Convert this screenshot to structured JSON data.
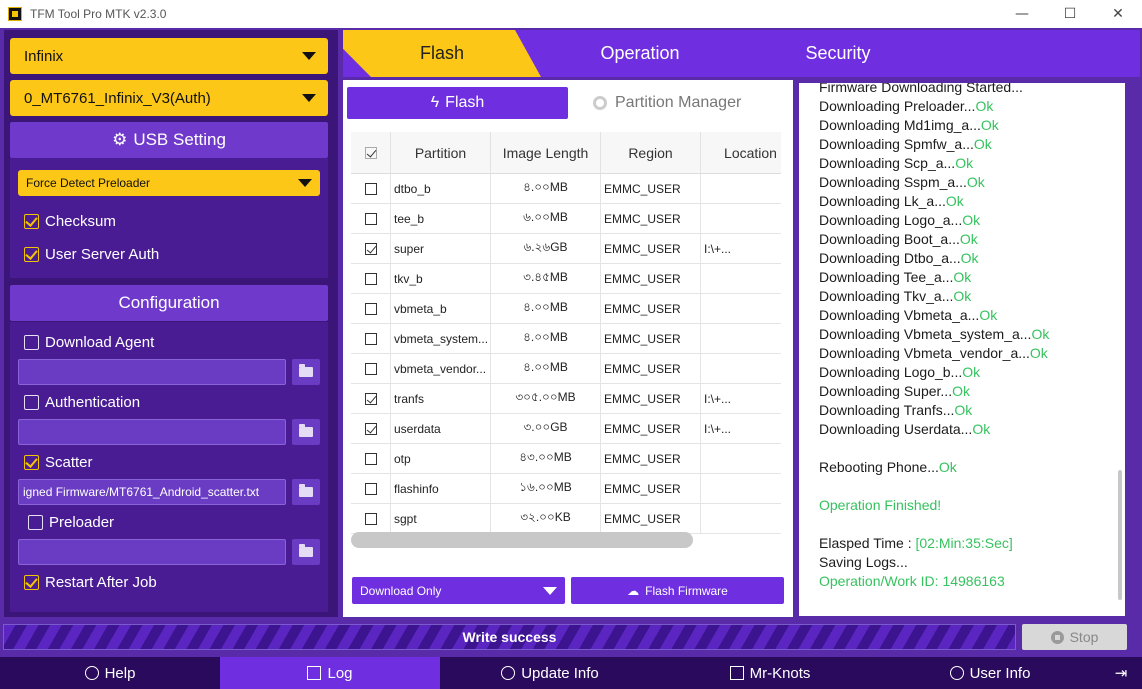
{
  "window": {
    "title": "TFM Tool Pro MTK v2.3.0",
    "minimize": "—",
    "maximize": "☐",
    "close": "✕"
  },
  "left": {
    "brand_select": "Infinix",
    "model_select": "0_MT6761_Infinix_V3(Auth)",
    "usb_setting": {
      "label": "USB Setting",
      "detect_mode": "Force Detect Preloader",
      "checksum": {
        "label": "Checksum",
        "checked": true
      },
      "user_server_auth": {
        "label": "User Server Auth",
        "checked": true
      }
    },
    "configuration": {
      "label": "Configuration",
      "download_agent": {
        "label": "Download Agent",
        "checked": false,
        "path": ""
      },
      "authentication": {
        "label": "Authentication",
        "checked": false,
        "path": ""
      },
      "scatter": {
        "label": "Scatter",
        "checked": true,
        "path": "igned Firmware/MT6761_Android_scatter.txt"
      },
      "preloader": {
        "label": "Preloader",
        "checked": false,
        "path": ""
      },
      "restart_after_job": {
        "label": "Restart After Job",
        "checked": true
      }
    }
  },
  "tabs": {
    "flash": "Flash",
    "operation": "Operation",
    "security": "Security"
  },
  "subtabs": {
    "flash": "Flash",
    "partition_manager": "Partition Manager"
  },
  "table": {
    "columns": [
      "Partition",
      "Image Length",
      "Region",
      "Location"
    ],
    "rows": [
      {
        "checked": false,
        "partition": "dtbo_b",
        "length": "৪.০০MB",
        "region": "EMMC_USER",
        "location": ""
      },
      {
        "checked": false,
        "partition": "tee_b",
        "length": "৬.০০MB",
        "region": "EMMC_USER",
        "location": ""
      },
      {
        "checked": true,
        "partition": "super",
        "length": "৬.২৬GB",
        "region": "EMMC_USER",
        "location": "I:\\+..."
      },
      {
        "checked": false,
        "partition": "tkv_b",
        "length": "৩.৪৫MB",
        "region": "EMMC_USER",
        "location": ""
      },
      {
        "checked": false,
        "partition": "vbmeta_b",
        "length": "৪.০০MB",
        "region": "EMMC_USER",
        "location": ""
      },
      {
        "checked": false,
        "partition": "vbmeta_system...",
        "length": "৪.০০MB",
        "region": "EMMC_USER",
        "location": ""
      },
      {
        "checked": false,
        "partition": "vbmeta_vendor...",
        "length": "৪.০০MB",
        "region": "EMMC_USER",
        "location": ""
      },
      {
        "checked": true,
        "partition": "tranfs",
        "length": "৩০৫.০০MB",
        "region": "EMMC_USER",
        "location": "I:\\+..."
      },
      {
        "checked": true,
        "partition": "userdata",
        "length": "৩.০০GB",
        "region": "EMMC_USER",
        "location": "I:\\+..."
      },
      {
        "checked": false,
        "partition": "otp",
        "length": "৪৩.০০MB",
        "region": "EMMC_USER",
        "location": ""
      },
      {
        "checked": false,
        "partition": "flashinfo",
        "length": "১৬.০০MB",
        "region": "EMMC_USER",
        "location": ""
      },
      {
        "checked": false,
        "partition": "sgpt",
        "length": "৩২.০০KB",
        "region": "EMMC_USER",
        "location": ""
      }
    ]
  },
  "actions": {
    "mode": "Download Only",
    "flash_firmware": "Flash Firmware"
  },
  "log": [
    {
      "text": "Firmware Downloading Started...",
      "ok": ""
    },
    {
      "text": "Downloading Preloader...",
      "ok": "Ok"
    },
    {
      "text": "Downloading Md1img_a...",
      "ok": "Ok"
    },
    {
      "text": "Downloading Spmfw_a...",
      "ok": "Ok"
    },
    {
      "text": "Downloading Scp_a...",
      "ok": "Ok"
    },
    {
      "text": "Downloading Sspm_a...",
      "ok": "Ok"
    },
    {
      "text": "Downloading Lk_a...",
      "ok": "Ok"
    },
    {
      "text": "Downloading Logo_a...",
      "ok": "Ok"
    },
    {
      "text": "Downloading Boot_a...",
      "ok": "Ok"
    },
    {
      "text": "Downloading Dtbo_a...",
      "ok": "Ok"
    },
    {
      "text": "Downloading Tee_a...",
      "ok": "Ok"
    },
    {
      "text": "Downloading Tkv_a...",
      "ok": "Ok"
    },
    {
      "text": "Downloading Vbmeta_a...",
      "ok": "Ok"
    },
    {
      "text": "Downloading Vbmeta_system_a...",
      "ok": "Ok"
    },
    {
      "text": "Downloading Vbmeta_vendor_a...",
      "ok": "Ok"
    },
    {
      "text": "Downloading Logo_b...",
      "ok": "Ok"
    },
    {
      "text": "Downloading Super...",
      "ok": "Ok"
    },
    {
      "text": "Downloading Tranfs...",
      "ok": "Ok"
    },
    {
      "text": "Downloading Userdata...",
      "ok": "Ok"
    },
    {
      "text": "",
      "ok": ""
    },
    {
      "text": "Rebooting Phone...",
      "ok": "Ok"
    },
    {
      "text": "",
      "ok": ""
    },
    {
      "text": "",
      "ok": "Operation Finished!"
    },
    {
      "text": "",
      "ok": ""
    },
    {
      "text": "Elasped Time    :  ",
      "ok": "[02:Min:35:Sec]"
    },
    {
      "text": "Saving Logs...",
      "ok": ""
    },
    {
      "text": "",
      "ok": "Operation/Work ID: 14986163"
    }
  ],
  "progress": {
    "label": "Write success",
    "value": 100,
    "stop": "Stop"
  },
  "nav": {
    "help": "Help",
    "log": "Log",
    "update_info": "Update Info",
    "mr_knots": "Mr-Knots",
    "user_info": "User Info",
    "exit": "⇥"
  },
  "colors": {
    "accent_purple": "#6f2ee0",
    "accent_yellow": "#fcc716",
    "ok_green": "#36c25f"
  }
}
